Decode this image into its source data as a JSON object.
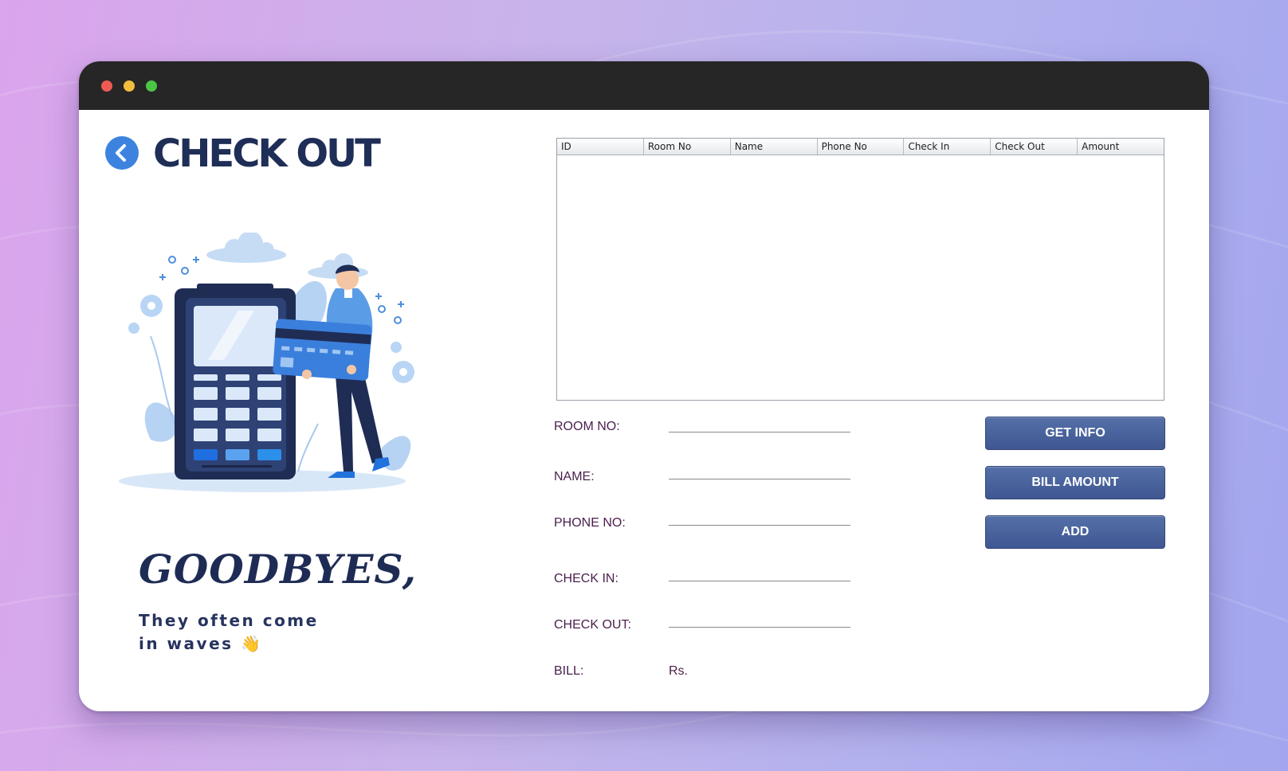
{
  "page": {
    "title": "CHECK OUT"
  },
  "hero": {
    "headline": "GOODBYES,",
    "tagline": "They often come in waves",
    "tagline_emoji": "👋"
  },
  "table": {
    "columns": [
      "ID",
      "Room No",
      "Name",
      "Phone No",
      "Check In",
      "Check Out",
      "Amount"
    ],
    "rows": []
  },
  "form": {
    "room_no_label": "ROOM NO:",
    "name_label": "NAME:",
    "phone_label": "PHONE NO:",
    "check_in_label": "CHECK IN:",
    "check_out_label": "CHECK OUT:",
    "bill_label": "BILL:",
    "bill_value": "Rs.",
    "room_no_value": "",
    "name_value": "",
    "phone_value": "",
    "check_in_value": "",
    "check_out_value": ""
  },
  "buttons": {
    "get_info": "GET INFO",
    "bill_amount": "BILL AMOUNT",
    "add": "ADD"
  },
  "colors": {
    "title": "#1f2e57",
    "label": "#4a1e4c",
    "button": "#4a64a0",
    "back_button": "#3c83e0",
    "titlebar": "#262626"
  },
  "icons": {
    "back": "chevron-left-icon",
    "illustration": "payment-terminal-illustration"
  }
}
